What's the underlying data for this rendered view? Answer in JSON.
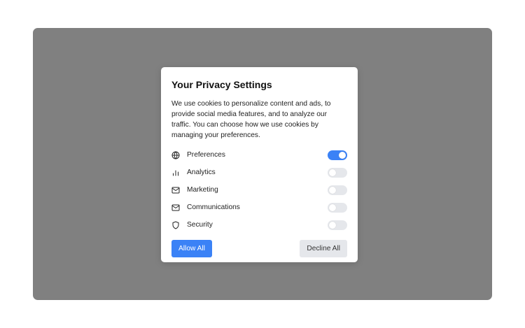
{
  "dialog": {
    "title": "Your Privacy Settings",
    "description": "We use cookies to personalize content and ads, to provide social media features, and to analyze our traffic. You can choose how we use cookies by managing your preferences.",
    "options": [
      {
        "label": "Preferences",
        "icon": "globe-icon",
        "enabled": true
      },
      {
        "label": "Analytics",
        "icon": "bar-chart-icon",
        "enabled": false
      },
      {
        "label": "Marketing",
        "icon": "mail-icon",
        "enabled": false
      },
      {
        "label": "Communications",
        "icon": "mail-icon",
        "enabled": false
      },
      {
        "label": "Security",
        "icon": "shield-icon",
        "enabled": false
      }
    ],
    "allow_all_label": "Allow All",
    "decline_all_label": "Decline All"
  },
  "colors": {
    "accent": "#3b82f6",
    "overlay": "#808080",
    "toggle_off": "#e5e7eb",
    "secondary_button": "#e5e7eb"
  }
}
